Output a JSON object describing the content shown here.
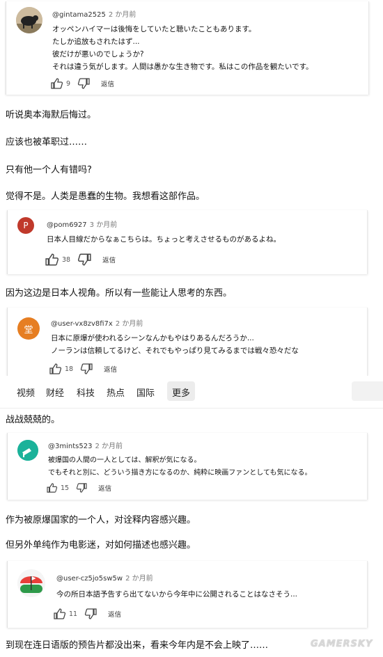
{
  "comments": [
    {
      "handle": "@gintama2525",
      "ago": "2 か月前",
      "lines": [
        "オッペンハイマーは後悔をしていたと聴いたこともあります。",
        "たしか追放もされたはず...",
        "彼だけが悪いのでしょうか?",
        "それは違う気がします。人間は愚かな生き物です。私はこの作品を観たいです。"
      ],
      "likes": "9",
      "reply_label": "返信"
    },
    {
      "handle": "@pom6927",
      "ago": "3 か月前",
      "avatar_letter": "P",
      "lines": [
        "日本人目線だからなぁこちらは。ちょっと考えさせるものがあるよね。"
      ],
      "likes": "38",
      "reply_label": "返信"
    },
    {
      "handle": "@user-vx8zv8fi7x",
      "ago": "2 か月前",
      "avatar_letter": "堂",
      "lines": [
        "日本に原爆が使われるシーンなんかもやはりあるんだろうか...",
        "ノーランは信頼してるけど、それでもやっぱり見てみるまでは戦々恐々だな"
      ],
      "likes": "18",
      "reply_label": "返信"
    },
    {
      "handle": "@3mints523",
      "ago": "2 か月前",
      "lines": [
        "被爆国の人間の一人としては、解釈が気になる。",
        "でもそれと別に、どういう描き方になるのか、純粋に映画ファンとしても気になる。"
      ],
      "likes": "15",
      "reply_label": "返信"
    },
    {
      "handle": "@user-cz5jo5sw5w",
      "ago": "2 か月前",
      "lines": [
        "今の所日本語予告すら出てないから今年中に公開されることはなさそう..."
      ],
      "likes": "11",
      "reply_label": "返信"
    }
  ],
  "translations": {
    "t1": "听说奥本海默后悔过。",
    "t2": "应该也被革职过……",
    "t3": "只有他一个人有错吗?",
    "t4": "觉得不是。人类是愚蠢的生物。我想看这部作品。",
    "t5": "因为这边是日本人视角。所以有一些能让人思考的东西。",
    "t6": "战战兢兢的。",
    "t7": "作为被原爆国家的一个人，对诠释内容感兴趣。",
    "t8": "但另外单纯作为电影迷，对如何描述也感兴趣。",
    "t9": "到现在连日语版的预告片都没出来，看来今年内是不会上映了……"
  },
  "nav": {
    "items": [
      "视频",
      "财经",
      "科技",
      "热点",
      "国际",
      "更多"
    ],
    "active": "更多"
  },
  "watermark": "GAMERSKY",
  "colors": {
    "pom_avatar": "#c0392b",
    "user_vx_avatar": "#e67e22",
    "accent_text": "#111111"
  }
}
